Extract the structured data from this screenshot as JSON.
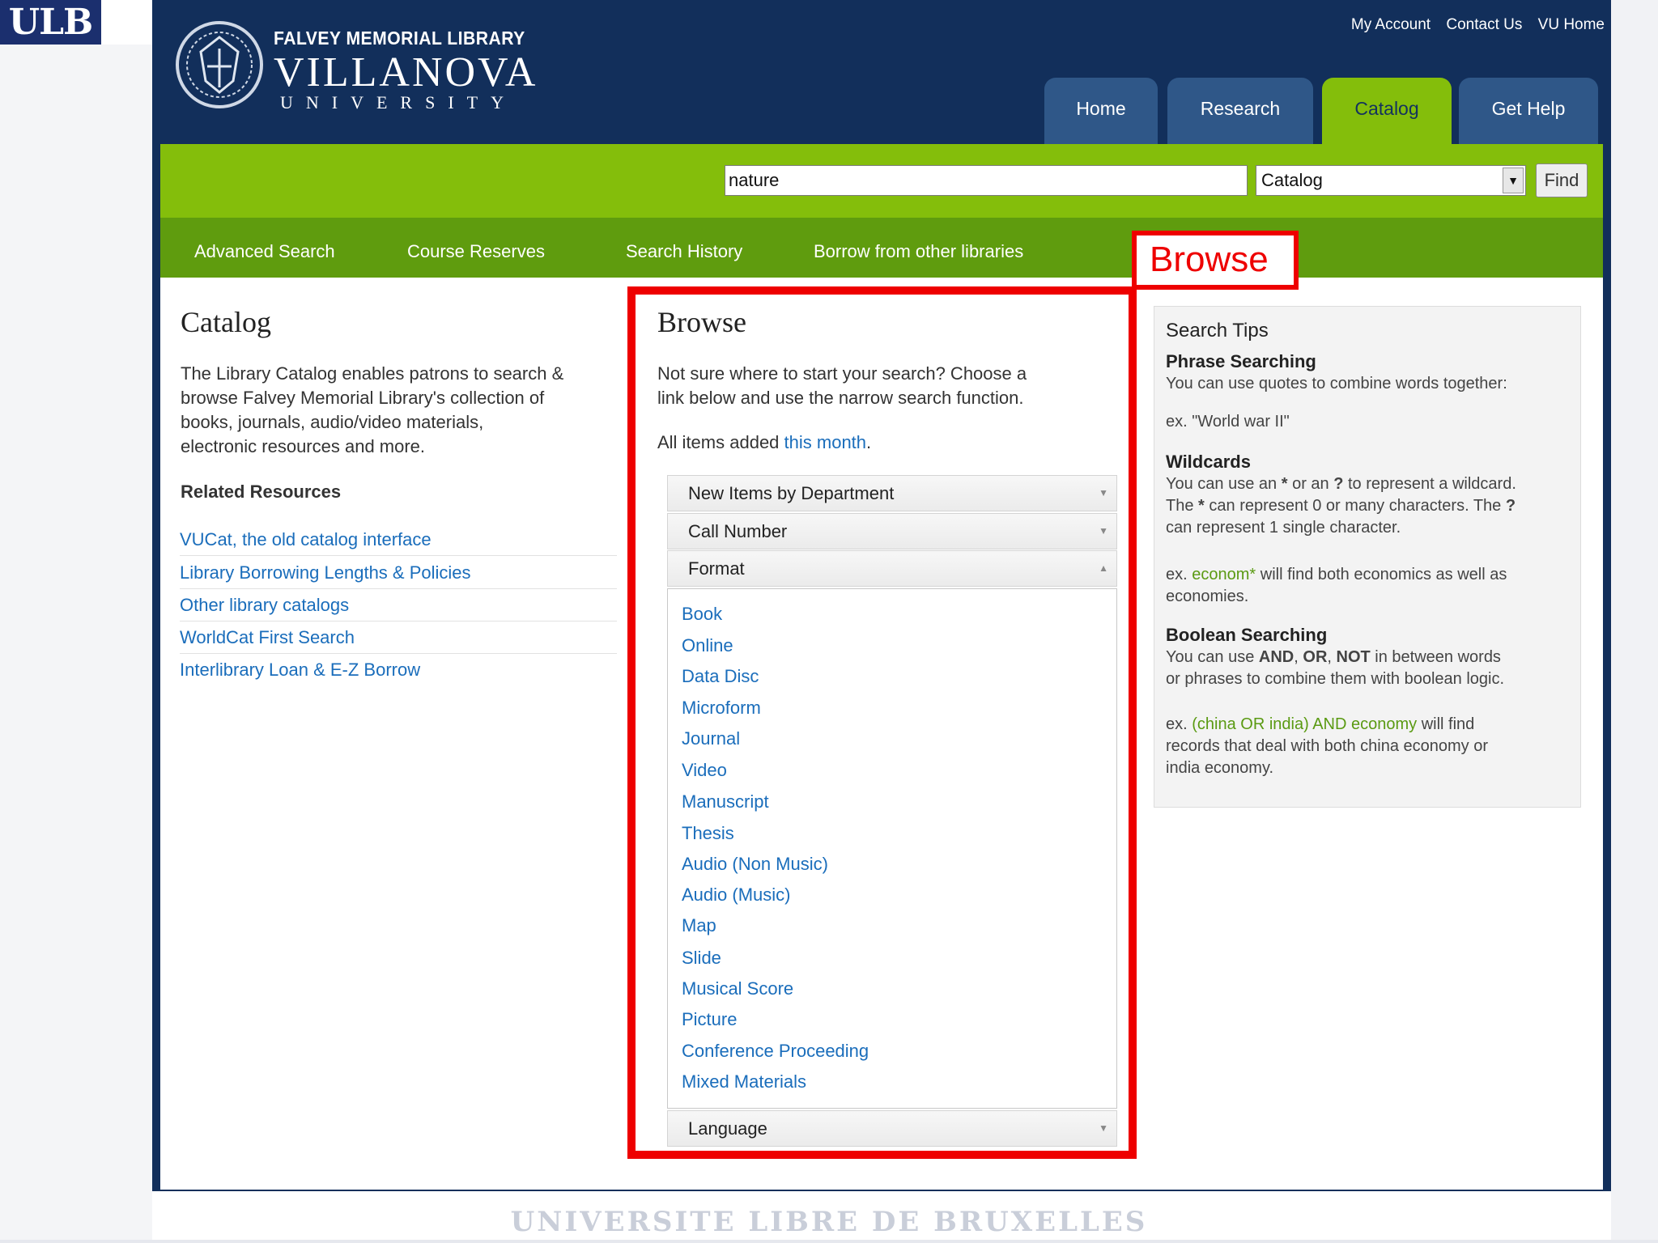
{
  "slide": {
    "logo_text": "ULB",
    "footer_text": "UNIVERSITE LIBRE DE BRUXELLES"
  },
  "header": {
    "library_name": "FALVEY MEMORIAL LIBRARY",
    "university_name": "VILLANOVA",
    "university_sub": "UNIVERSITY",
    "top_links": [
      "My Account",
      "Contact Us",
      "VU Home"
    ],
    "tabs": [
      "Home",
      "Research",
      "Catalog",
      "Get Help"
    ],
    "active_tab": "Catalog"
  },
  "search": {
    "query": "nature",
    "scope": "Catalog",
    "find_label": "Find"
  },
  "subnav": [
    "Advanced Search",
    "Course Reserves",
    "Search History",
    "Borrow from other libraries"
  ],
  "catalog": {
    "title": "Catalog",
    "description_lines": [
      "The Library Catalog enables patrons to search &",
      "browse Falvey Memorial Library's collection of",
      "books, journals, audio/video materials,",
      "electronic resources and more."
    ],
    "related_heading": "Related Resources",
    "related_links": [
      "VUCat, the old catalog interface",
      "Library Borrowing Lengths & Policies",
      "Other library catalogs",
      "WorldCat First Search",
      "Interlibrary Loan & E-Z Borrow"
    ]
  },
  "browse": {
    "title": "Browse",
    "intro_lines": [
      "Not sure where to start your search? Choose a",
      "link below and use the narrow search function."
    ],
    "all_items_prefix": "All items added ",
    "all_items_link": "this month",
    "all_items_suffix": ".",
    "sections": [
      "New Items by Department",
      "Call Number",
      "Format",
      "Language"
    ],
    "formats": [
      "Book",
      "Online",
      "Data Disc",
      "Microform",
      "Journal",
      "Video",
      "Manuscript",
      "Thesis",
      "Audio (Non Music)",
      "Audio (Music)",
      "Map",
      "Slide",
      "Musical Score",
      "Picture",
      "Conference Proceeding",
      "Mixed Materials"
    ]
  },
  "tips": {
    "title": "Search Tips",
    "phrase_heading": "Phrase Searching",
    "phrase_text": "You can use quotes to combine words together:",
    "phrase_example": "ex. \"World war II\"",
    "wild_heading": "Wildcards",
    "wild_line1_a": "You can use an ",
    "wild_star": "*",
    "wild_line1_b": " or an ",
    "wild_q": "?",
    "wild_line1_c": " to represent a wildcard.",
    "wild_line2_a": "The ",
    "wild_line2_b": " can represent 0 or many characters. The ",
    "wild_line3": "can represent 1 single character.",
    "wild_ex_prefix": "ex. ",
    "wild_ex_term": "econom*",
    "wild_ex_suffix": " will find both economics as well as",
    "wild_ex_line2": "economies.",
    "bool_heading": "Boolean Searching",
    "bool_line1_a": "You can use ",
    "bool_and": "AND",
    "bool_comma1": ", ",
    "bool_or": "OR",
    "bool_comma2": ", ",
    "bool_not": "NOT",
    "bool_line1_b": " in between words",
    "bool_line2": "or phrases to combine them with boolean logic.",
    "bool_ex_prefix": "ex. ",
    "bool_ex_term": "(china OR india) AND economy",
    "bool_ex_suffix": " will find",
    "bool_ex_line2": "records that deal with both china economy or",
    "bool_ex_line3": "india economy."
  },
  "annotation": {
    "label": "Browse",
    "color": "#ee0000"
  },
  "colors": {
    "navy": "#122f5b",
    "green": "#84be0b",
    "dark_green": "#5f9c0e",
    "link": "#1a6dbb"
  }
}
